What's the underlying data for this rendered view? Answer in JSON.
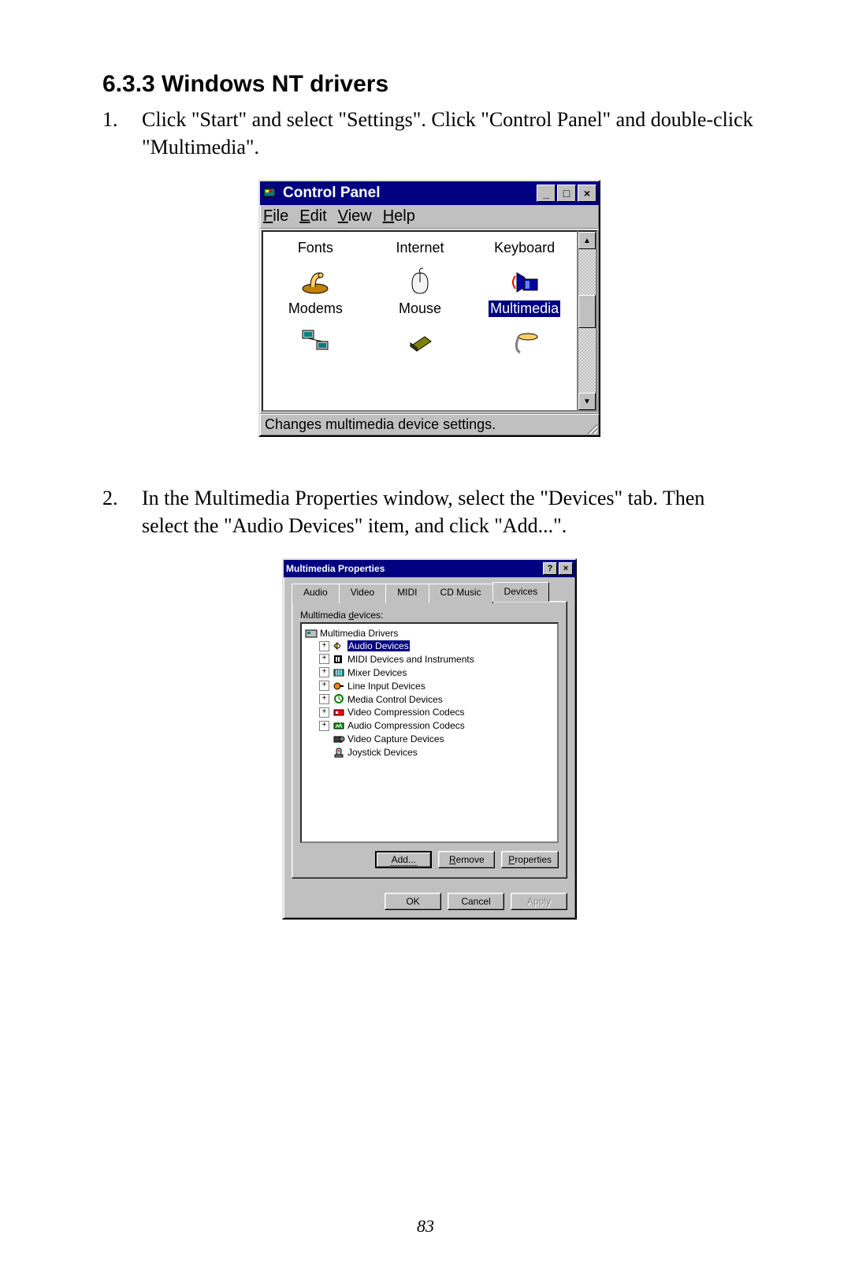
{
  "heading": "6.3.3 Windows NT drivers",
  "steps": [
    {
      "num": "1.",
      "text": "Click \"Start\" and select \"Settings\". Click \"Control Panel\" and double-click \"Multimedia\"."
    },
    {
      "num": "2.",
      "text": "In the Multimedia Properties window, select the \"Devices\" tab. Then select the \"Audio Devices\" item, and click \"Add...\"."
    }
  ],
  "page_number": "83",
  "control_panel": {
    "title": "Control Panel",
    "menu": [
      "File",
      "Edit",
      "View",
      "Help"
    ],
    "row1": [
      "Fonts",
      "Internet",
      "Keyboard"
    ],
    "row2": [
      "Modems",
      "Mouse",
      "Multimedia"
    ],
    "selected": "Multimedia",
    "status": "Changes multimedia device settings."
  },
  "multimedia": {
    "title": "Multimedia Properties",
    "tabs": [
      "Audio",
      "Video",
      "MIDI",
      "CD Music",
      "Devices"
    ],
    "active_tab": "Devices",
    "list_label": "Multimedia devices:",
    "root": "Multimedia Drivers",
    "children": [
      {
        "label": "Audio Devices",
        "selected": true,
        "exp": true
      },
      {
        "label": "MIDI Devices and Instruments",
        "exp": true
      },
      {
        "label": "Mixer Devices",
        "exp": true
      },
      {
        "label": "Line Input Devices",
        "exp": true
      },
      {
        "label": "Media Control Devices",
        "exp": true
      },
      {
        "label": "Video Compression Codecs",
        "exp": true
      },
      {
        "label": "Audio Compression Codecs",
        "exp": true
      },
      {
        "label": "Video Capture Devices",
        "exp": false
      },
      {
        "label": "Joystick Devices",
        "exp": false
      }
    ],
    "buttons": {
      "add": "Add...",
      "remove": "Remove",
      "properties": "Properties",
      "ok": "OK",
      "cancel": "Cancel",
      "apply": "Apply"
    }
  }
}
